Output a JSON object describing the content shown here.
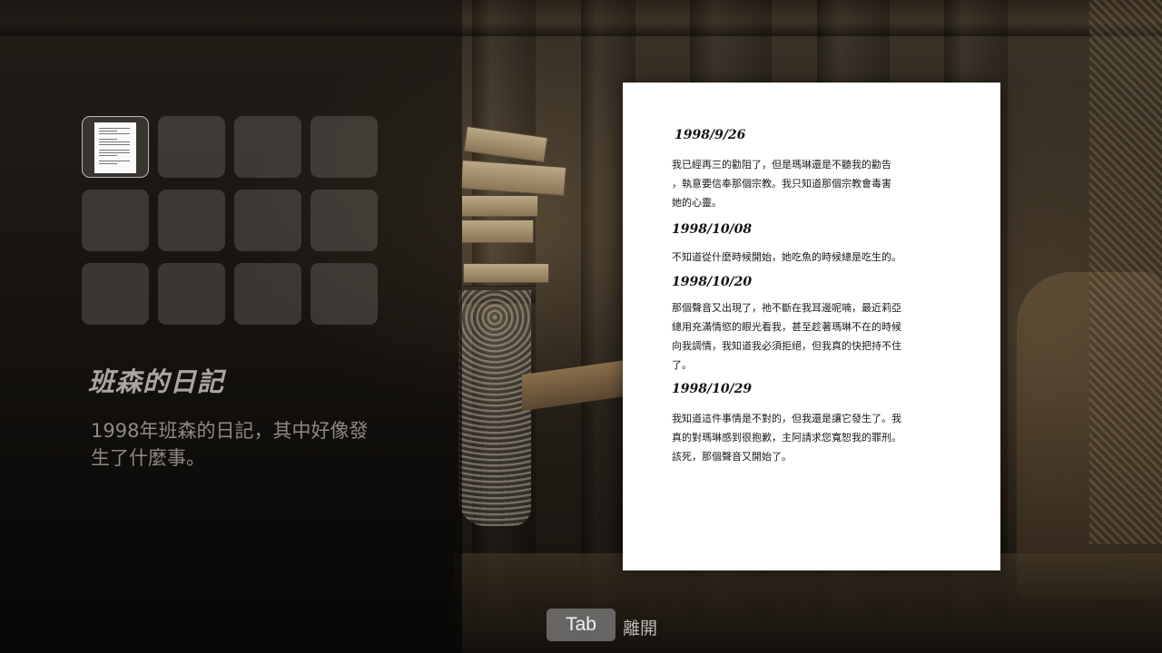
{
  "inventory": {
    "slots": [
      {
        "filled": true,
        "selected": true,
        "icon": "document-icon"
      },
      {
        "filled": false
      },
      {
        "filled": false
      },
      {
        "filled": false
      },
      {
        "filled": false
      },
      {
        "filled": false
      },
      {
        "filled": false
      },
      {
        "filled": false
      },
      {
        "filled": false
      },
      {
        "filled": false
      },
      {
        "filled": false
      },
      {
        "filled": false
      }
    ]
  },
  "item": {
    "title": "班森的日記",
    "description": "1998年班森的日記，其中好像發生了什麼事。"
  },
  "document": {
    "entries": [
      {
        "date": "1998/9/26",
        "lines": [
          "我已經再三的勸阻了，但是瑪琳還是不聽我的勸告",
          "，執意要信奉那個宗教。我只知道那個宗教會毒害",
          "她的心靈。"
        ]
      },
      {
        "date": "1998/10/08",
        "lines": [
          "不知道從什麼時候開始，她吃魚的時候總是吃生的。"
        ]
      },
      {
        "date": "1998/10/20",
        "lines": [
          "那個聲音又出現了，祂不斷在我耳邊呢喃，最近莉亞",
          "總用充滿情慾的眼光看我，甚至趁著瑪琳不在的時候",
          "向我調情，我知道我必須拒絕，但我真的快把持不住",
          "了。"
        ]
      },
      {
        "date": "1998/10/29",
        "lines": [
          "我知道這件事情是不對的，但我還是讓它發生了。我",
          "真的對瑪琳感到很抱歉，主阿請求您寬恕我的罪刑。",
          "該死，那個聲音又開始了。"
        ]
      }
    ]
  },
  "prompt": {
    "key": "Tab",
    "action": "離開"
  }
}
